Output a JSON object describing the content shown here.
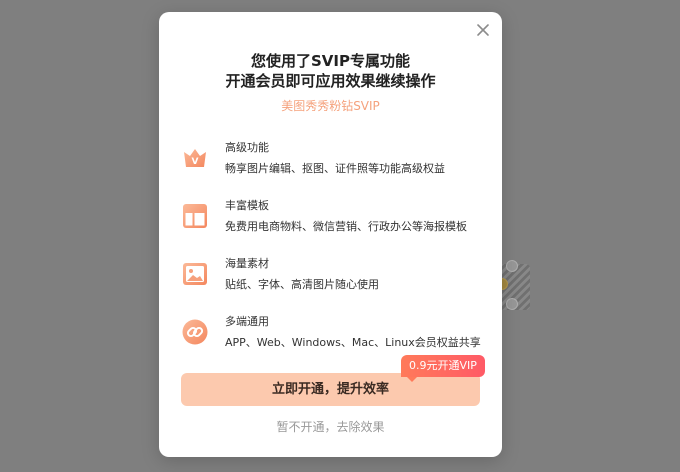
{
  "modal": {
    "title_line1": "您使用了SVIP专属功能",
    "title_line2": "开通会员即可应用效果继续操作",
    "subtitle": "美图秀秀粉钻SVIP",
    "close_icon": "close-icon"
  },
  "features": [
    {
      "icon": "crown-v-icon",
      "title": "高级功能",
      "desc": "畅享图片编辑、抠图、证件照等功能高级权益"
    },
    {
      "icon": "template-icon",
      "title": "丰富模板",
      "desc": "免费用电商物料、微信营销、行政办公等海报模板"
    },
    {
      "icon": "image-icon",
      "title": "海量素材",
      "desc": "贴纸、字体、高清图片随心使用"
    },
    {
      "icon": "link-icon",
      "title": "多端通用",
      "desc": "APP、Web、Windows、Mac、Linux会员权益共享"
    }
  ],
  "cta": {
    "label": "立即开通，提升效率",
    "badge": "0.9元开通VIP"
  },
  "skip": {
    "label": "暂不开通，去除效果"
  },
  "colors": {
    "accent": "#f5a27d",
    "cta_bg": "#fcc9ae",
    "badge_start": "#ff7a5a",
    "badge_end": "#ff5a66",
    "overlay": "#7f7f7f"
  }
}
